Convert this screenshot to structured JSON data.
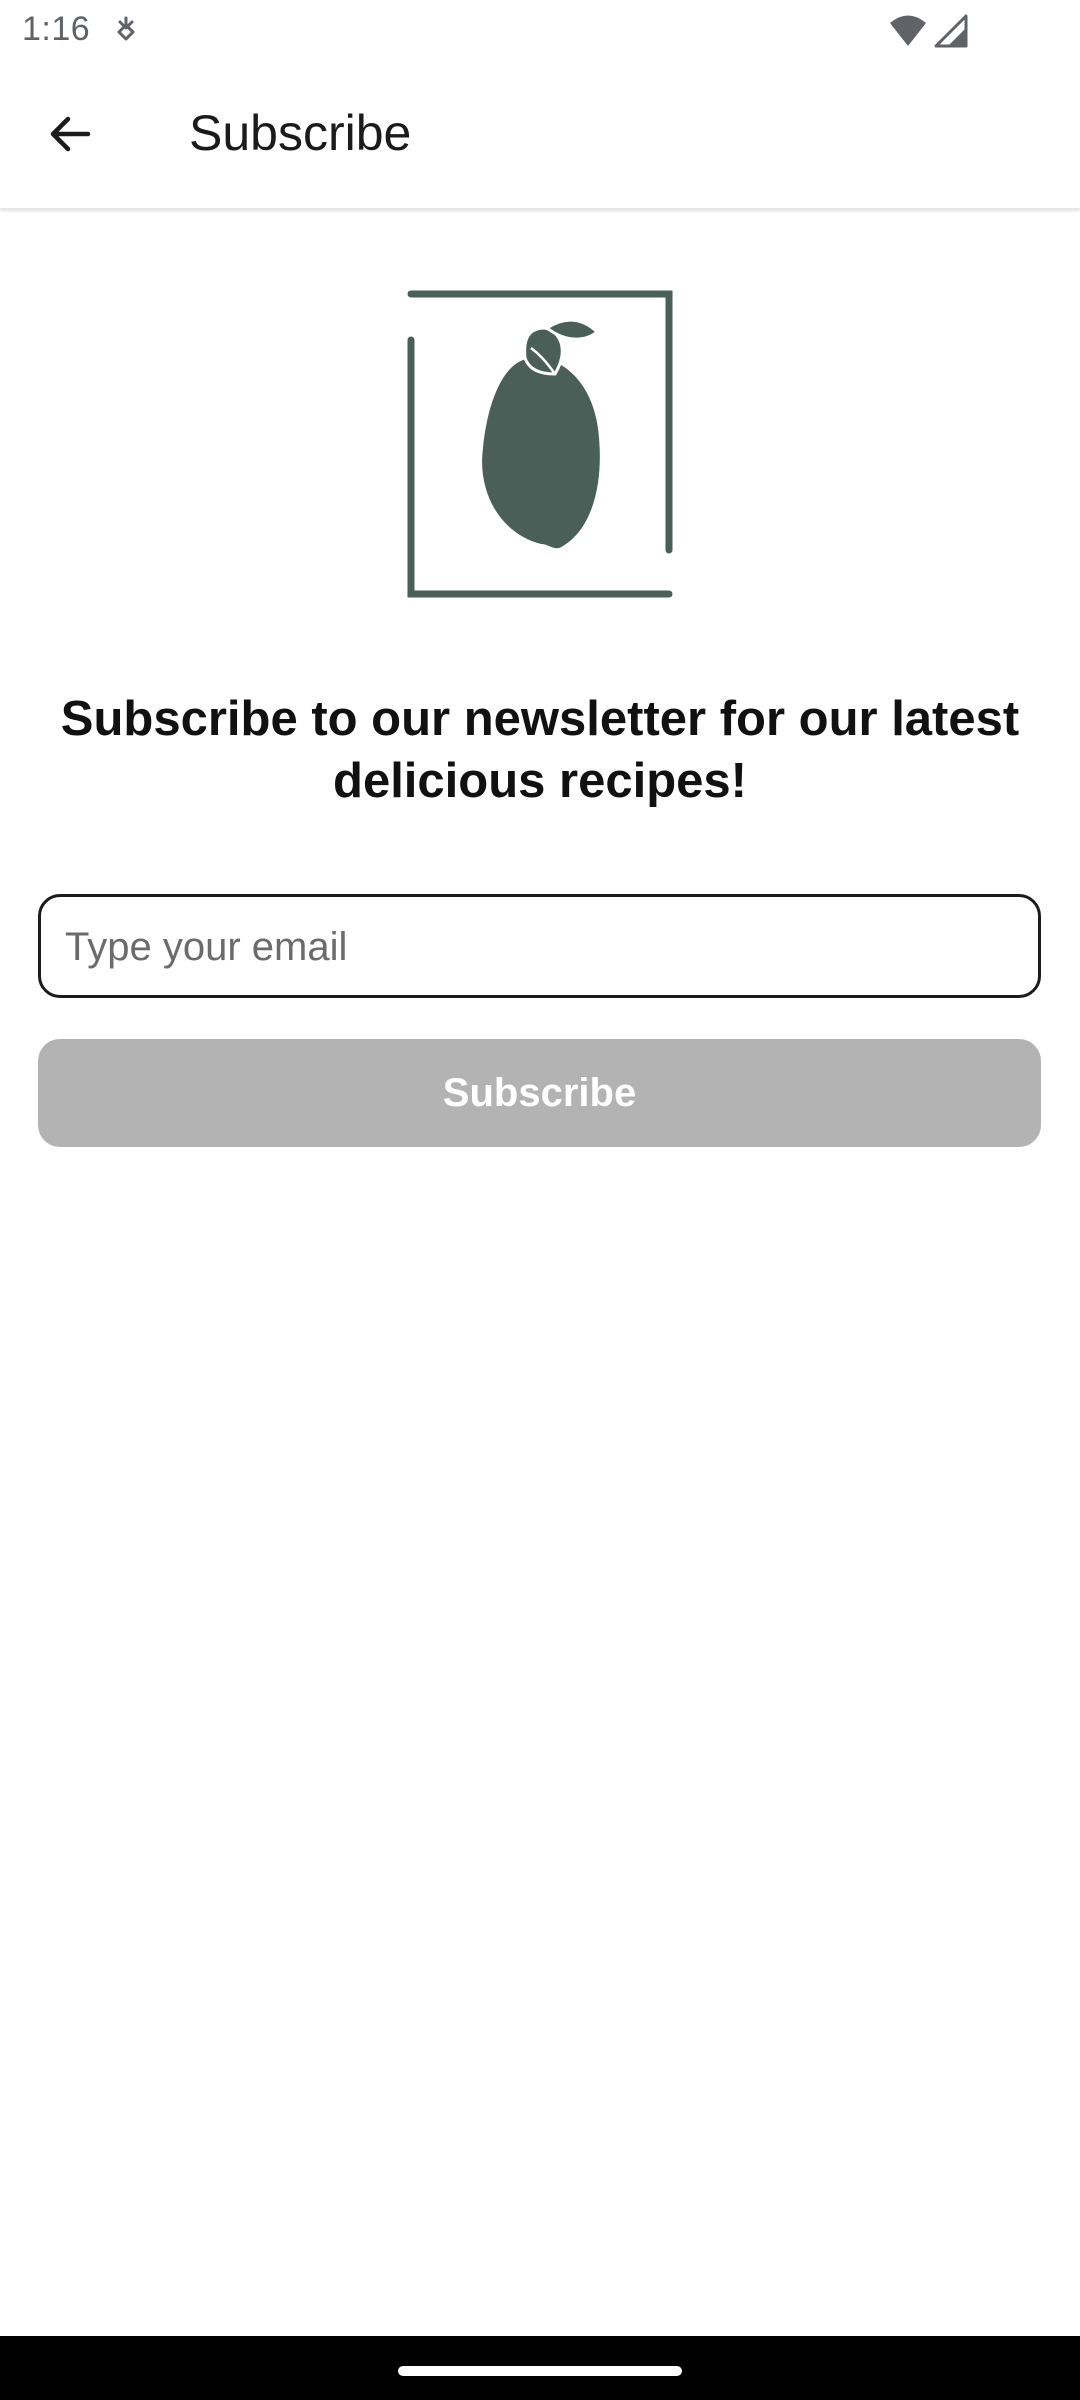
{
  "status_bar": {
    "time": "1:16",
    "icons": [
      "notification-icon",
      "wifi-icon",
      "signal-icon"
    ]
  },
  "app_bar": {
    "back_icon": "arrow-back-icon",
    "title": "Subscribe"
  },
  "logo": {
    "icon": "lemon-logo-icon",
    "color": "#4a5f58"
  },
  "main": {
    "headline": "Subscribe to our newsletter for our latest delicious recipes!",
    "email": {
      "value": "",
      "placeholder": "Type your email"
    },
    "subscribe_label": "Subscribe",
    "subscribe_disabled_color": "#b3b3b3"
  },
  "nav_bar": {
    "handle": "home-handle"
  }
}
